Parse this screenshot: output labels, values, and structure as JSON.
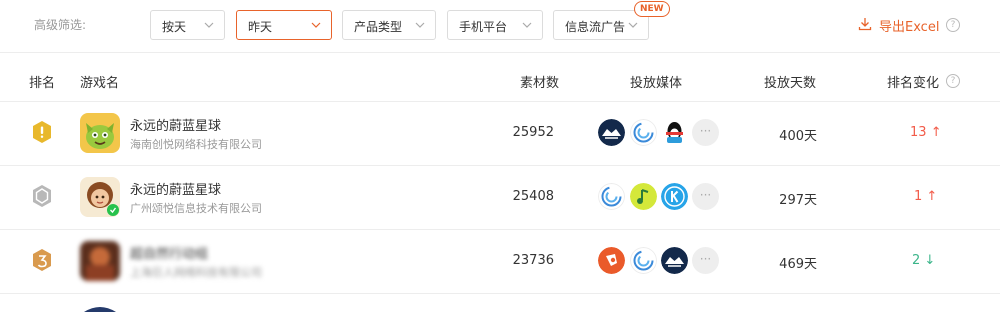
{
  "filters": {
    "label": "高级筛选:",
    "dropdowns": [
      {
        "label": "按天",
        "active": false
      },
      {
        "label": "昨天",
        "active": true
      },
      {
        "label": "产品类型",
        "active": false
      },
      {
        "label": "手机平台",
        "active": false
      },
      {
        "label": "信息流广告",
        "active": false
      }
    ],
    "new_badge": "NEW",
    "export_label": "导出Excel",
    "help_icon": "?"
  },
  "table": {
    "headers": {
      "rank": "排名",
      "game": "游戏名",
      "materials": "素材数",
      "media": "投放媒体",
      "days": "投放天数",
      "change": "排名变化"
    },
    "rows": [
      {
        "rank": "1",
        "rank_color": "#e8b82c",
        "name": "永远的蔚蓝星球",
        "company": "海南创悦网络科技有限公司",
        "materials": "25952",
        "media_icons": [
          "eagle-media-icon",
          "spiral-media-icon",
          "qq-penguin-media-icon",
          "more-icon"
        ],
        "more_label": "···",
        "days": "400天",
        "change": "13",
        "direction": "up",
        "arrow": "↑"
      },
      {
        "rank": "2",
        "rank_color": "#b8b8b8",
        "name": "永远的蔚蓝星球",
        "company": "广州颂悦信息技术有限公司",
        "materials": "25408",
        "media_icons": [
          "spiral-media-icon",
          "music-note-media-icon",
          "k-media-icon",
          "more-icon"
        ],
        "more_label": "···",
        "days": "297天",
        "change": "1",
        "direction": "up",
        "arrow": "↑"
      },
      {
        "rank": "3",
        "rank_color": "#d99a4e",
        "name": "超自然行动组",
        "company": "上海巨人网络科技有限公司",
        "materials": "23736",
        "media_icons": [
          "pangle-media-icon",
          "spiral-media-icon",
          "eagle-media-icon",
          "more-icon"
        ],
        "more_label": "···",
        "days": "469天",
        "change": "2",
        "direction": "down",
        "arrow": "↓"
      }
    ]
  },
  "colors": {
    "accent": "#e8632b",
    "up": "#f25c4a",
    "down": "#3bb58a"
  }
}
